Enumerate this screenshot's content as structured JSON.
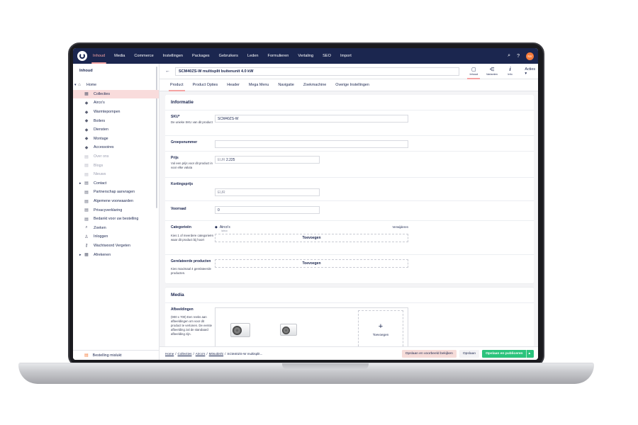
{
  "topnav": {
    "items": [
      "Inhoud",
      "Media",
      "Commerce",
      "Instellingen",
      "Packages",
      "Gebruikers",
      "Leden",
      "Formulieren",
      "Vertaling",
      "SEO",
      "Import"
    ],
    "active": "Inhoud",
    "avatar_initials": "NV",
    "search_icon": "⌕",
    "help_icon": "?"
  },
  "sidebar": {
    "header": "Inhoud",
    "items": [
      {
        "label": "Home",
        "icon": "⌂"
      },
      {
        "label": "Collecties",
        "icon": "▦"
      },
      {
        "label": "Airco's",
        "icon": "◆"
      },
      {
        "label": "Warmtepompen",
        "icon": "◆"
      },
      {
        "label": "Boilers",
        "icon": "◆"
      },
      {
        "label": "Diensten",
        "icon": "◆"
      },
      {
        "label": "Montage",
        "icon": "◆"
      },
      {
        "label": "Accessoires",
        "icon": "◆"
      },
      {
        "label": "Over ons",
        "icon": "▤"
      },
      {
        "label": "Blogs",
        "icon": "▤"
      },
      {
        "label": "Nieuws",
        "icon": "▤"
      },
      {
        "label": "Contact",
        "icon": "▤"
      },
      {
        "label": "Partnerschap aanvragen",
        "icon": "▤"
      },
      {
        "label": "Algemene voorwaarden",
        "icon": "▤"
      },
      {
        "label": "Privacyverklaring",
        "icon": "▤"
      },
      {
        "label": "Bedankt voor uw bestelling",
        "icon": "▤"
      },
      {
        "label": "Zoeken",
        "icon": "⌕"
      },
      {
        "label": "Inloggen",
        "icon": "♙"
      },
      {
        "label": "Wachtwoord Vergeten",
        "icon": "⚷"
      },
      {
        "label": "Afrekenen",
        "icon": "▦"
      }
    ],
    "footer": "Bestelling mislukt"
  },
  "editor": {
    "back": "←",
    "title": "SCM40ZS-W multisplit buitenunit 4.0 kW",
    "apps": [
      {
        "label": "Inhoud",
        "icon": "▢"
      },
      {
        "label": "Varianten",
        "icon": "⋲"
      },
      {
        "label": "Info",
        "icon": "i"
      }
    ],
    "acties": "Acties ▾",
    "tabs": [
      "Product",
      "Product Opties",
      "Header",
      "Mega Menu",
      "Navigatie",
      "Zoekmachine",
      "Overige Instellingen"
    ]
  },
  "informatie": {
    "title": "Informatie",
    "sku": {
      "label": "SKU*",
      "desc": "De unieke SKU van dit product",
      "value": "SCM40ZS-W"
    },
    "groepsnummer": {
      "label": "Groepsnummer"
    },
    "prijs": {
      "label": "Prijs",
      "desc": "Vul een prijs voor dit product in voor elke valuta",
      "currency": "EUR",
      "value": "2.225"
    },
    "kortingsprijs": {
      "label": "Kortingsprijs",
      "currency": "EUR"
    },
    "voorraad": {
      "label": "Voorraad",
      "value": "0"
    },
    "categorieën": {
      "label": "Categorieën",
      "desc": "Kies 1 of meerdere categorieën waar dit product bij hoort",
      "item": "Airco's",
      "item_sub": "/airco",
      "remove": "Verwijderen",
      "add": "Toevoegen"
    },
    "gerelateerde": {
      "label": "Gerelateerde producten",
      "desc": "Kies maximaal 4 gerelateerde producten.",
      "add": "Toevoegen"
    }
  },
  "media": {
    "title": "Media",
    "afbeeldingen": {
      "label": "Afbeeldingen",
      "desc": "(900 x 700) Een reeks aan afbeeldingen om voor dit product te vertonen. De eerste afbeelding zal de standaard afbeelding zijn.",
      "upload": "Toevoegen"
    }
  },
  "footer": {
    "crumbs": [
      "Home",
      "Collecties",
      "Airco's",
      "Mitsubishi",
      "SCM40ZS-W multisplit..."
    ],
    "btn_preview": "Opslaan en voorbeeld bekijken",
    "btn_save": "Opslaan",
    "btn_publish": "Opslaan en publiceren"
  }
}
